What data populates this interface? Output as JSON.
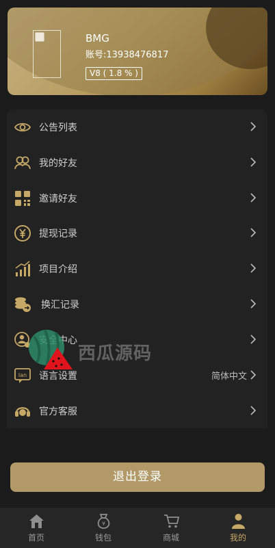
{
  "profile": {
    "name": "BMG",
    "account": "账号:13938476817",
    "vip": "V8 ( 1.8 % )"
  },
  "menu": [
    {
      "label": "公告列表",
      "icon": "eye-icon"
    },
    {
      "label": "我的好友",
      "icon": "friends-icon"
    },
    {
      "label": "邀请好友",
      "icon": "qr-code-icon"
    },
    {
      "label": "提现记录",
      "icon": "yen-coin-icon"
    },
    {
      "label": "项目介绍",
      "icon": "bar-chart-icon"
    },
    {
      "label": "换汇记录",
      "icon": "coin-exchange-icon"
    },
    {
      "label": "安全中心",
      "icon": "user-shield-icon"
    },
    {
      "label": "语言设置",
      "icon": "language-icon",
      "value": "简体中文"
    },
    {
      "label": "官方客服",
      "icon": "headset-icon"
    }
  ],
  "watermark": "西瓜源码",
  "logout_label": "退出登录",
  "tabs": [
    {
      "label": "首页",
      "icon": "home-icon"
    },
    {
      "label": "钱包",
      "icon": "wallet-bag-icon"
    },
    {
      "label": "商城",
      "icon": "cart-icon"
    },
    {
      "label": "我的",
      "icon": "user-icon",
      "active": true
    }
  ],
  "colors": {
    "accent": "#b19a68",
    "active_tab": "#c6a867",
    "background": "#1b1b1b"
  }
}
